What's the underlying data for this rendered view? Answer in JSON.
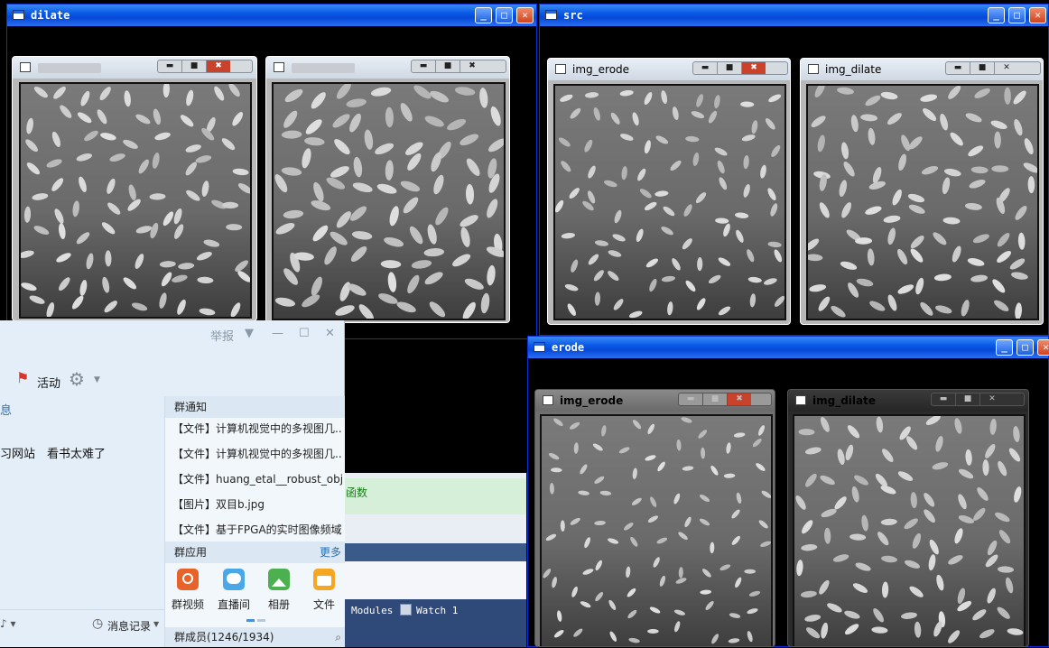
{
  "windows": {
    "dilate": {
      "title": "dilate",
      "btn_min": "_",
      "btn_max": "□",
      "btn_close": "✕"
    },
    "src": {
      "title": "src",
      "btn_min": "_",
      "btn_max": "□",
      "btn_close": "✕"
    },
    "erode": {
      "title": "erode",
      "btn_min": "_",
      "btn_max": "□",
      "btn_close": "✕"
    }
  },
  "subwindows": {
    "src_erode": "img_erode",
    "src_dilate": "img_dilate",
    "erode_erode": "img_erode",
    "erode_dilate": "img_dilate"
  },
  "qq": {
    "report": "举报",
    "activity": "活动",
    "left_fragment": "息",
    "message_line": "习网站　看书太难了",
    "notice_header": "群通知",
    "notices": [
      "【文件】计算机视觉中的多视图几...",
      "【文件】计算机视觉中的多视图几...",
      "【文件】huang_etal__robust_object...",
      "【图片】双目b.jpg",
      "【文件】基于FPGA的实时图像频域..."
    ],
    "apps_header": "群应用",
    "more": "更多",
    "apps": [
      "群视频",
      "直播间",
      "相册",
      "文件"
    ],
    "history": "消息记录",
    "members": "群成员(1246/1934)"
  },
  "vs": {
    "func_text": "函数",
    "modules": "Modules",
    "watch": "Watch 1"
  }
}
